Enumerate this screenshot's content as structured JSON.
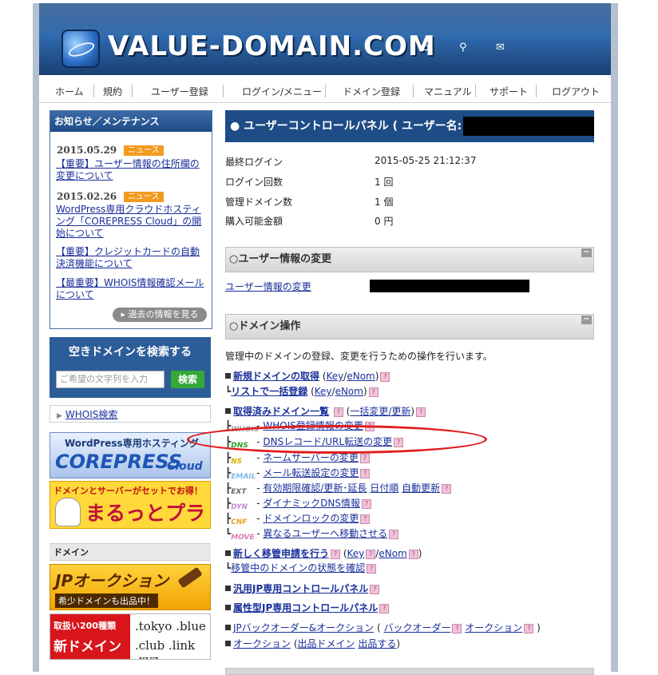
{
  "header": {
    "logo_text": "VALUE-DOMAIN.COM",
    "icons": [
      "home-icon",
      "search-icon",
      "mail-icon"
    ]
  },
  "nav": [
    "ホーム",
    "規約",
    "ユーザー登録",
    "ログイン/メニュー",
    "ドメイン登録",
    "マニュアル",
    "サポート",
    "ログアウト"
  ],
  "news": {
    "title": "お知らせ／メンテナンス",
    "items": [
      {
        "date": "2015.05.29",
        "badge": "ニュース",
        "text": "【重要】ユーザー情報の住所欄の変更について"
      },
      {
        "date": "2015.02.26",
        "badge": "ニュース",
        "text": "WordPress専用クラウドホスティング「COREPRESS Cloud」の開始について"
      },
      {
        "text": "【重要】クレジットカードの自動決済機能について"
      },
      {
        "text": "【最重要】WHOIS情報確認メールについて"
      }
    ],
    "more": "過去の情報を見る"
  },
  "search": {
    "title": "空きドメインを検索する",
    "placeholder": "ご希望の文字列を入力",
    "button": "検索"
  },
  "whois_link": "WHOIS検索",
  "banners": {
    "corepress_top": "WordPress専用ホスティング",
    "corepress_main": "COREPRESS",
    "corepress_sub": "Cloud",
    "maruto_top": "ドメインとサーバーがセットでお得！",
    "maruto_main": "まるっとプラン",
    "domain_label": "ドメイン",
    "jp_main": "JPオークション",
    "jp_sub": "希少ドメインも出品中！",
    "new_a": "取扱い200種類",
    "new_b": "新ドメイン",
    "tlds_1": ".tokyo .blue",
    "tlds_2": ".club .link .xyz"
  },
  "panel": {
    "title": "● ユーザーコントロールパネル ( ユーザー名:",
    "info": [
      {
        "label": "最終ログイン",
        "value": "2015-05-25 21:12:37"
      },
      {
        "label": "ログイン回数",
        "value": "1 回"
      },
      {
        "label": "管理ドメイン数",
        "value": "1 個"
      },
      {
        "label": "購入可能金額",
        "value": "0 円"
      }
    ]
  },
  "user_section": {
    "title": "○ユーザー情報の変更",
    "link": "ユーザー情報の変更"
  },
  "domain_section": {
    "title": "○ドメイン操作",
    "desc": "管理中のドメインの登録、変更を行うための操作を行います。",
    "new_domain": "新規ドメインの取得",
    "key": "Key",
    "enom": "eNom",
    "bulk_list": "リストで一括登録",
    "acquired_list": "取得済みドメイン一覧",
    "bulk_change": "一括変更/更新",
    "whois_change": "WHOIS登録情報の変更",
    "dns_change": "DNSレコード/URL転送の変更",
    "ns_change": "ネームサーバーの変更",
    "mail_forward": "メール転送設定の変更",
    "expiry": "有効期限確認/更新･延長",
    "by_date": "日付順",
    "auto_renew": "自動更新",
    "dyndns": "ダイナミックDNS情報",
    "lock": "ドメインロックの変更",
    "move": "異なるユーザーへ移動させる",
    "transfer_in": "新しく移管申請を行う",
    "transfer_status": "移管中のドメインの状態を確認",
    "generic_jp": "汎用JP専用コントロールパネル",
    "attr_jp": "属性型JP専用コントロールパネル",
    "backorder_auction": "JPバックオーダー&オークション",
    "backorder": "バックオーダー",
    "auction": "オークション",
    "listed": "出品ドメイン",
    "sell": "出品する",
    "tags": [
      "WHOIS",
      "DNS",
      "NS",
      "EMAIL",
      "EXT",
      "DYN",
      "CNF",
      "MOVE"
    ]
  },
  "colors": {
    "header": "#2a5d9c",
    "link": "#1a2f9a",
    "annotation": "#e11c1c",
    "badge": "#f39a1e"
  }
}
